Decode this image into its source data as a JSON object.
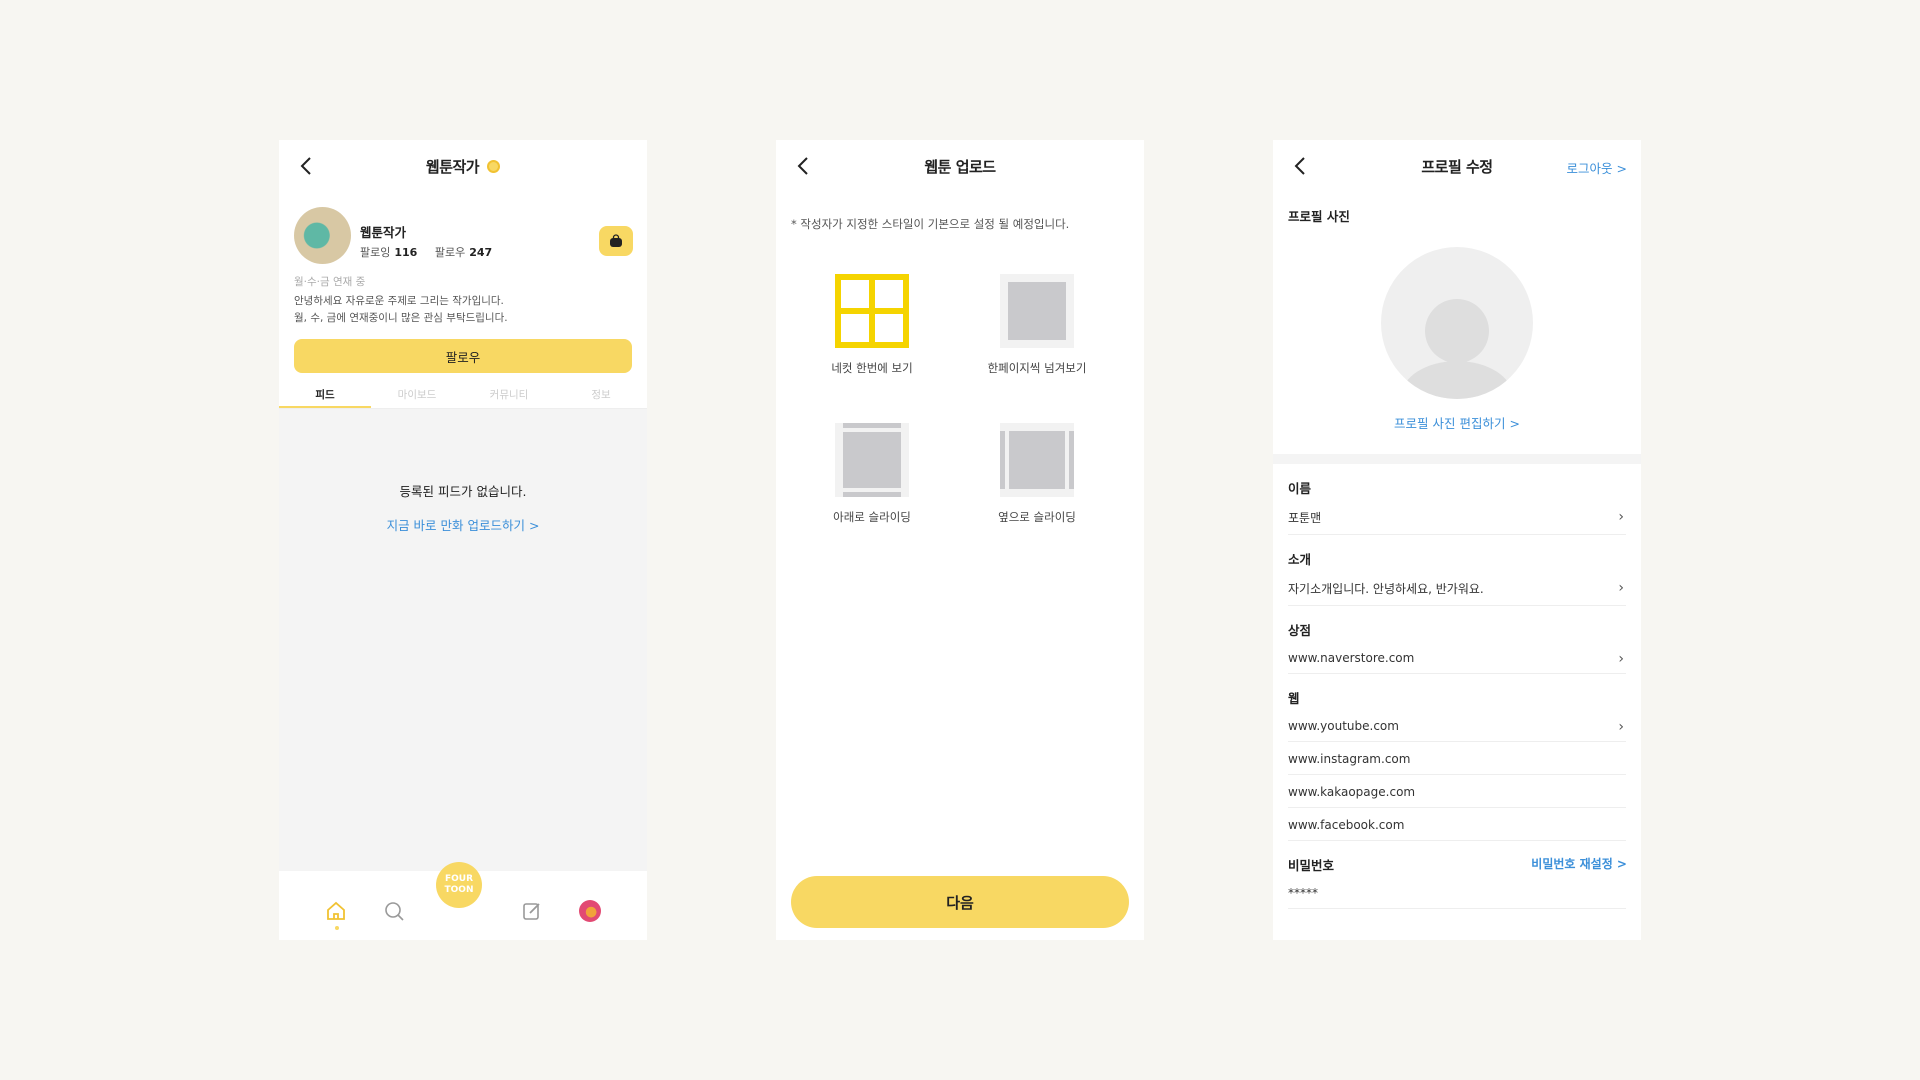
{
  "screen1": {
    "title": "웹툰작가",
    "name": "웹툰작가",
    "following_label": "팔로잉",
    "following_count": "116",
    "follower_label": "팔로우",
    "follower_count": "247",
    "status": "월·수·금 연재 중",
    "intro_line1": "안녕하세요 자유로운 주제로 그리는 작가입니다.",
    "intro_line2": "월, 수, 금에 연재중이니 많은 관심 부탁드립니다.",
    "follow_button": "팔로우",
    "tabs": [
      "피드",
      "마이보드",
      "커뮤니티",
      "정보"
    ],
    "empty_message": "등록된 피드가 없습니다.",
    "upload_link": "지금 바로 만화 업로드하기 >",
    "logo_text": "FOUR TOON"
  },
  "screen2": {
    "title": "웹툰 업로드",
    "note": "* 작성자가 지정한 스타일이 기본으로 설정 될 예정입니다.",
    "options": [
      "네컷 한번에 보기",
      "한페이지씩 넘겨보기",
      "아래로 슬라이딩",
      "옆으로 슬라이딩"
    ],
    "next_button": "다음",
    "accent": "#f8d863",
    "selected_color": "#f5d400"
  },
  "screen3": {
    "title": "프로필 수정",
    "logout": "로그아웃 >",
    "photo_section": "프로필 사진",
    "edit_photo": "프로필 사진 편집하기 >",
    "name_label": "이름",
    "name_value": "포툰맨",
    "intro_label": "소개",
    "intro_value": "자기소개입니다. 안녕하세요, 반가워요.",
    "shop_label": "상점",
    "shop_value": "www.naverstore.com",
    "web_label": "웹",
    "web_values": [
      "www.youtube.com",
      "www.instagram.com",
      "www.kakaopage.com",
      "www.facebook.com"
    ],
    "password_label": "비밀번호",
    "password_reset": "비밀번호 재설정 >",
    "password_value": "*****",
    "link_color": "#3b8fd9"
  }
}
